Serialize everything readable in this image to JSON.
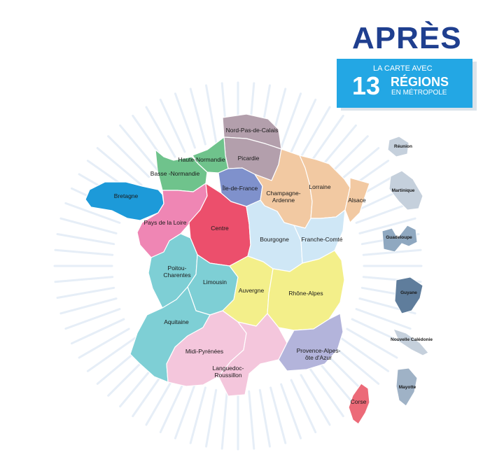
{
  "title": "APRÈS",
  "banner": {
    "line1": "LA CARTE AVEC",
    "number": "13",
    "line2": "RÉGIONS",
    "line3": "EN MÉTROPOLE"
  },
  "regions": [
    {
      "key": "nord",
      "label": "Nord-Pas-de-Calais",
      "color": "#b39fac"
    },
    {
      "key": "picardie",
      "label": "Picardie",
      "color": "#b39fac"
    },
    {
      "key": "haute_normandie",
      "label": "Haute-Normandie",
      "color": "#6fc38c"
    },
    {
      "key": "basse_normandie",
      "label": "Basse -Normandie",
      "color": "#6fc38c"
    },
    {
      "key": "bretagne",
      "label": "Bretagne",
      "color": "#1d9ad9"
    },
    {
      "key": "idf",
      "label": "Île-de-France",
      "color": "#7f91cc"
    },
    {
      "key": "champagne",
      "label": "Champagne-Ardenne",
      "color": "#f2c9a2"
    },
    {
      "key": "lorraine",
      "label": "Lorraine",
      "color": "#f2c9a2"
    },
    {
      "key": "alsace",
      "label": "Alsace",
      "color": "#f2c9a2"
    },
    {
      "key": "pdl",
      "label": "Pays de la Loire",
      "color": "#ef86b4"
    },
    {
      "key": "centre",
      "label": "Centre",
      "color": "#ec4f6c"
    },
    {
      "key": "bourgogne",
      "label": "Bourgogne",
      "color": "#cfe7f6"
    },
    {
      "key": "franche",
      "label": "Franche-Comté",
      "color": "#cfe7f6"
    },
    {
      "key": "poitou",
      "label": "Poitou-Charentes",
      "color": "#7ecfd5"
    },
    {
      "key": "limousin",
      "label": "Limousin",
      "color": "#7ecfd5"
    },
    {
      "key": "aquitaine",
      "label": "Aquitaine",
      "color": "#7ecfd5"
    },
    {
      "key": "auvergne",
      "label": "Auvergne",
      "color": "#f3ef8a"
    },
    {
      "key": "rhone",
      "label": "Rhône-Alpes",
      "color": "#f3ef8a"
    },
    {
      "key": "midi",
      "label": "Midi-Pyrénées",
      "color": "#f4c6dc"
    },
    {
      "key": "languedoc",
      "label": "Languedoc-Roussillon",
      "color": "#f4c6dc"
    },
    {
      "key": "paca",
      "label": "Provence-Alpes-Côte d'Azur",
      "color": "#b3b4db"
    },
    {
      "key": "corse",
      "label": "Corse",
      "color": "#ec6a78"
    }
  ],
  "overseas": [
    {
      "key": "reunion",
      "label": "Réunion",
      "color": "#c5d0dc"
    },
    {
      "key": "martinique",
      "label": "Martinique",
      "color": "#c5d0dc"
    },
    {
      "key": "guadeloupe",
      "label": "Guadeloupe",
      "color": "#8fa8c0"
    },
    {
      "key": "guyane",
      "label": "Guyane",
      "color": "#5f7d9c"
    },
    {
      "key": "caledonie",
      "label": "Nouvelle Calédonie",
      "color": "#c5d0dc"
    },
    {
      "key": "mayotte",
      "label": "Mayotte",
      "color": "#9fb2c6"
    }
  ]
}
